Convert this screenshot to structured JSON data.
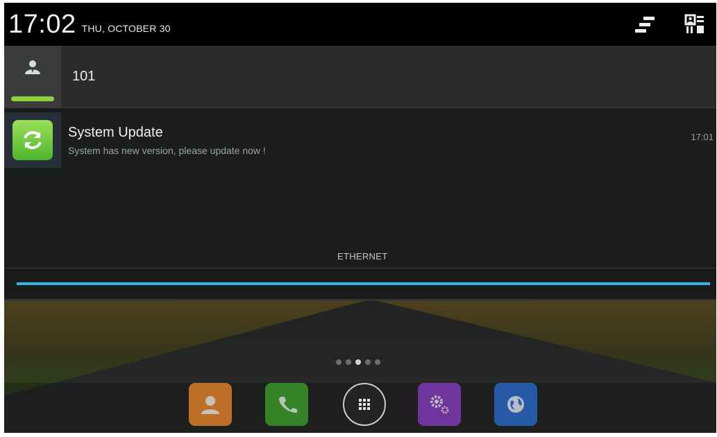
{
  "status_bar": {
    "time": "17:02",
    "date": "THU, OCTOBER 30",
    "icons": [
      "quick-settings-toggle-icon",
      "settings-grid-icon"
    ]
  },
  "user": {
    "icon": "user-icon",
    "name": "101"
  },
  "notification": {
    "icon": "system-update-icon",
    "title": "System Update",
    "body": "System has new version, please update now !",
    "time": "17:01"
  },
  "network": {
    "label": "ETHERNET"
  },
  "home": {
    "page_count": 5,
    "active_page": 2,
    "dock": [
      {
        "name": "contacts-icon",
        "color": "#f08a2a"
      },
      {
        "name": "phone-icon",
        "color": "#3fa62a"
      },
      {
        "name": "app-drawer-icon",
        "color": "#3a3a3a"
      },
      {
        "name": "settings-icon",
        "color": "#8a3dc8"
      },
      {
        "name": "browser-icon",
        "color": "#2a6fd6"
      }
    ]
  },
  "colors": {
    "accent": "#33b5e5",
    "user_active": "#8dd43a"
  }
}
